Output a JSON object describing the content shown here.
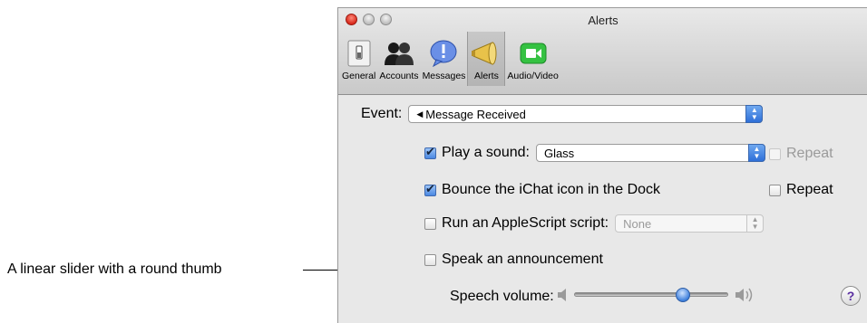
{
  "annotation": {
    "text": "A linear slider with a round thumb"
  },
  "window": {
    "title": "Alerts"
  },
  "toolbar": {
    "items": [
      {
        "label": "General",
        "icon": "switch-icon"
      },
      {
        "label": "Accounts",
        "icon": "people-icon"
      },
      {
        "label": "Messages",
        "icon": "speech-bubble-icon"
      },
      {
        "label": "Alerts",
        "icon": "megaphone-icon",
        "selected": true
      },
      {
        "label": "Audio/Video",
        "icon": "video-camera-icon"
      }
    ]
  },
  "event": {
    "label": "Event:",
    "value": "Message Received"
  },
  "play_sound": {
    "label": "Play a sound:",
    "checked": true,
    "value": "Glass",
    "repeat_label": "Repeat",
    "repeat_checked": false
  },
  "bounce": {
    "label": "Bounce the iChat icon in the Dock",
    "checked": true,
    "repeat_label": "Repeat",
    "repeat_checked": false
  },
  "applescript": {
    "label": "Run an AppleScript script:",
    "checked": false,
    "value": "None"
  },
  "speak": {
    "label": "Speak an announcement",
    "checked": false
  },
  "speech_volume": {
    "label": "Speech volume:",
    "level": 0.72
  },
  "help": {
    "label": "?"
  },
  "colors": {
    "accent": "#3d7fdc",
    "close": "#d8291c"
  }
}
